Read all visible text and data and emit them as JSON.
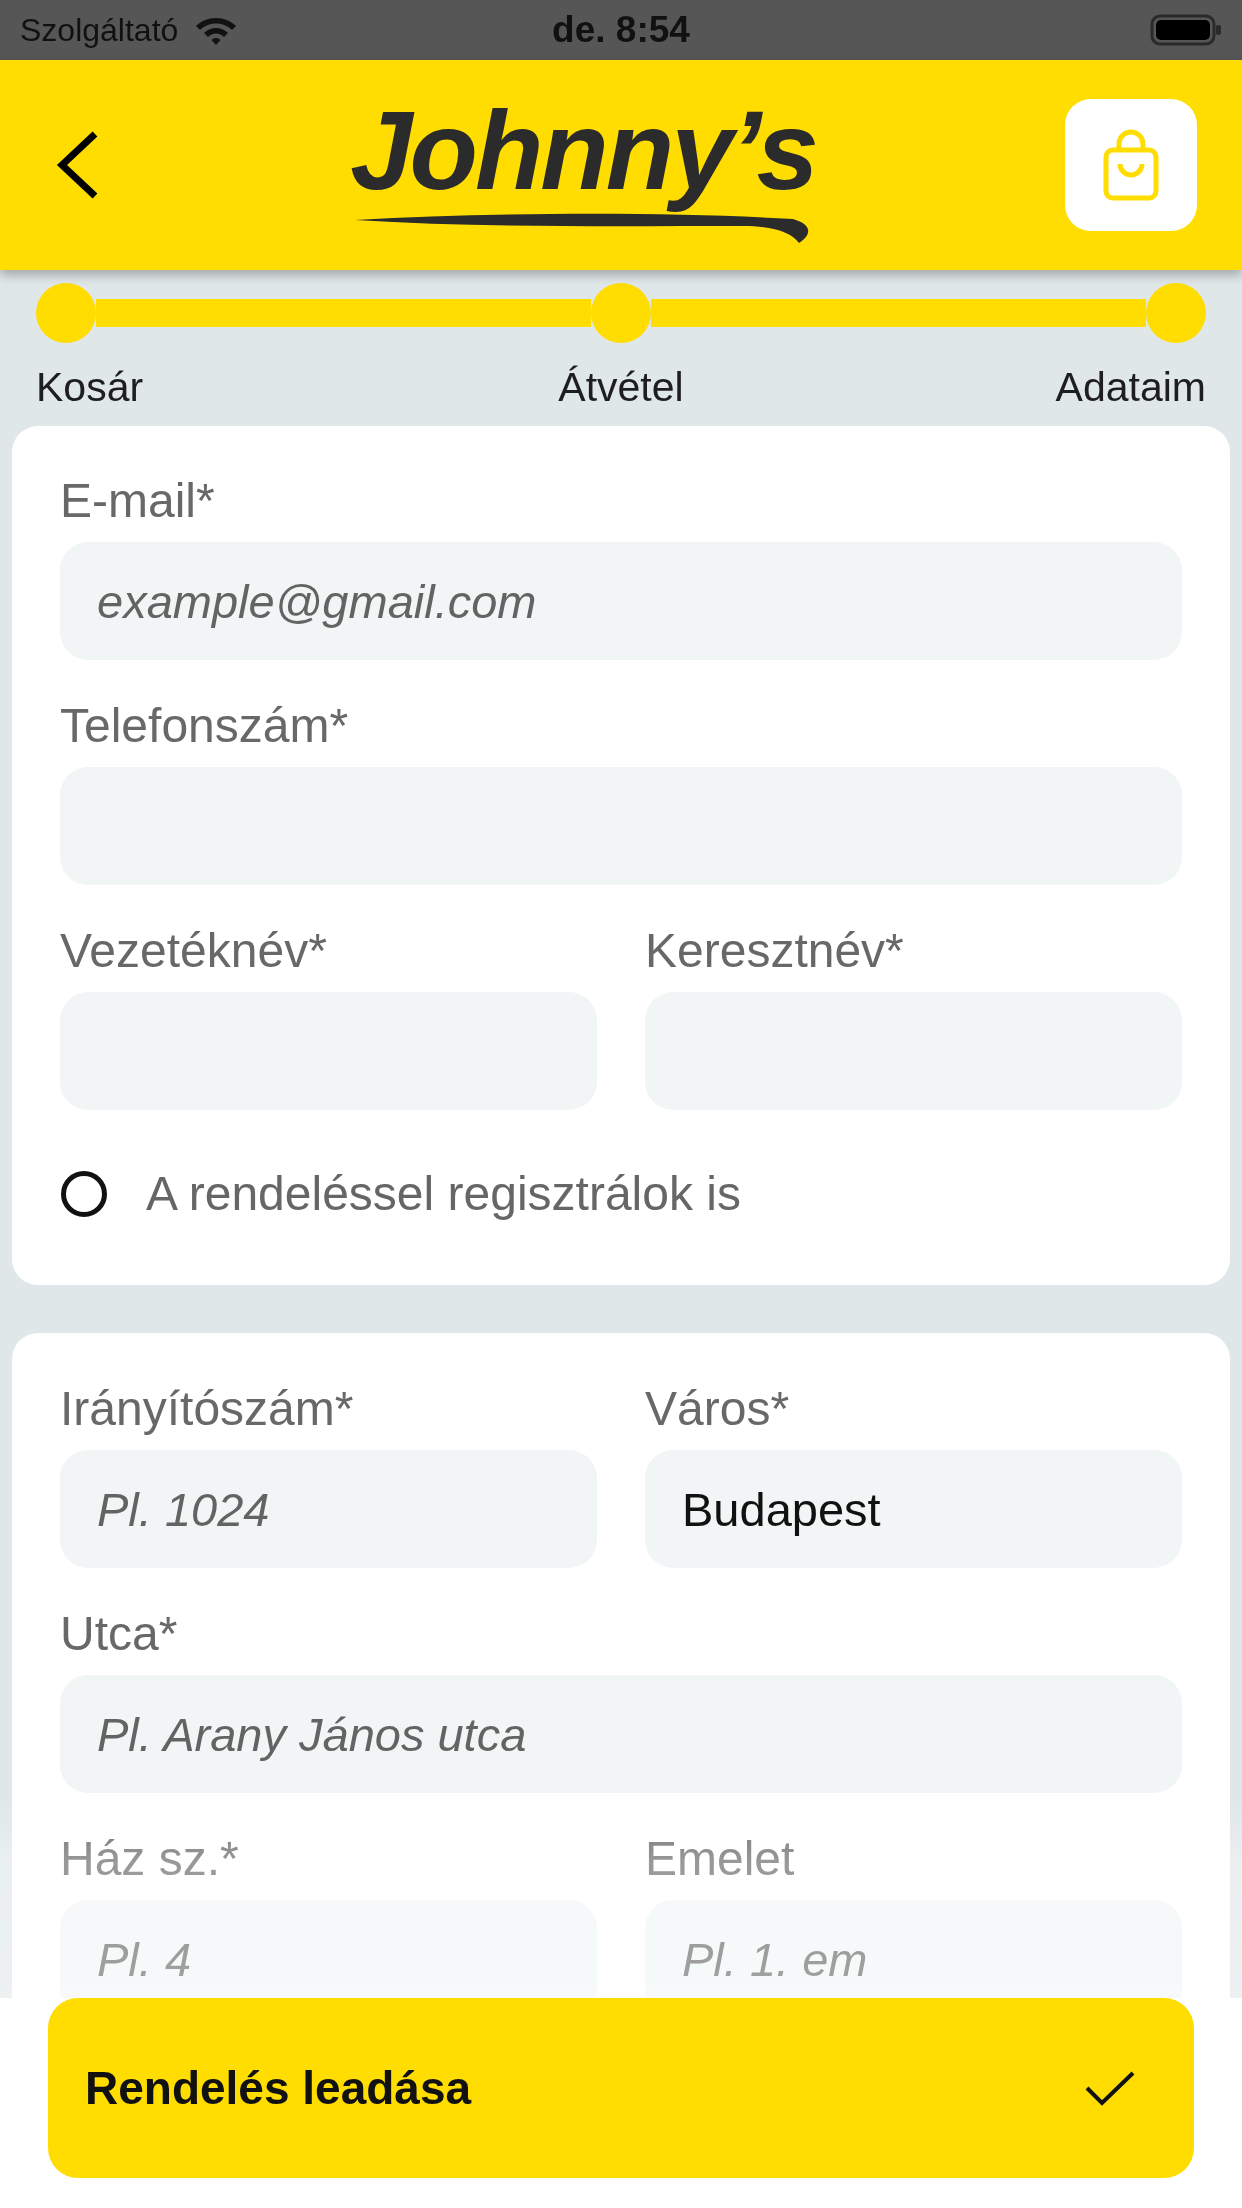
{
  "status_bar": {
    "carrier": "Szolgáltató",
    "time": "de. 8:54"
  },
  "header": {
    "logo": "Johnny’s"
  },
  "progress": {
    "steps": [
      {
        "label": "Kosár",
        "done": true
      },
      {
        "label": "Átvétel",
        "done": true
      },
      {
        "label": "Adataim",
        "done": true
      }
    ]
  },
  "sections": [
    {
      "rows": [
        [
          {
            "label": "E-mail*",
            "placeholder": "example@gmail.com"
          }
        ],
        [
          {
            "label": "Telefonszám*"
          }
        ],
        [
          {
            "label": "Vezetéknév*"
          },
          {
            "label": "Keresztnév*"
          }
        ]
      ],
      "option": {
        "label": "A rendeléssel regisztrálok is",
        "checked": false
      }
    },
    {
      "rows": [
        [
          {
            "label": "Irányítószám*",
            "placeholder": "Pl. 1024"
          },
          {
            "label": "Város*",
            "value": "Budapest"
          }
        ],
        [
          {
            "label": "Utca*",
            "placeholder": "Pl. Arany János utca"
          }
        ],
        [
          {
            "label": "Ház sz.*",
            "placeholder": "Pl. 4"
          },
          {
            "label": "Emelet",
            "placeholder": "Pl. 1. em"
          }
        ]
      ]
    }
  ],
  "submit_button": {
    "label": "Rendelés leadása"
  }
}
